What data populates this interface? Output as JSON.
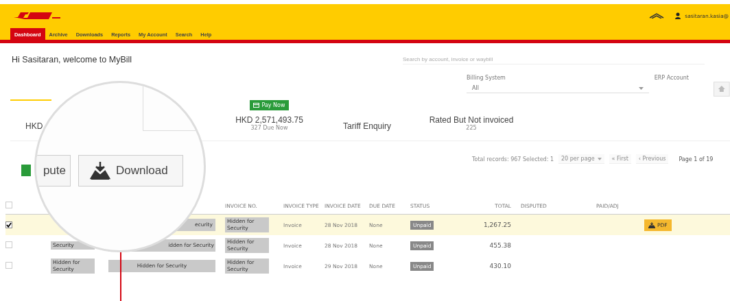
{
  "header": {
    "user": "sasitaran.kasia@"
  },
  "nav": [
    {
      "label": "Dashboard",
      "selected": true
    },
    {
      "label": "Archive",
      "selected": false
    },
    {
      "label": "Downloads",
      "selected": false
    },
    {
      "label": "Reports",
      "selected": false
    },
    {
      "label": "My Account",
      "selected": false
    },
    {
      "label": "Search",
      "selected": false
    },
    {
      "label": "Help",
      "selected": false
    }
  ],
  "welcome": "Hi Sasitaran, welcome to MyBill",
  "search": {
    "placeholder": "Search by account, invoice or waybill"
  },
  "filters": [
    {
      "label": "Billing System",
      "value": "All"
    },
    {
      "label": "ERP Account"
    }
  ],
  "summary": [
    {
      "title": "HKD",
      "selected": true
    },
    {
      "badge": "Pay Now",
      "title": "HKD 2,571,493.75",
      "sub": "327 Due Now",
      "selected": false
    },
    {
      "title": "Tariff Enquiry",
      "selected": false
    },
    {
      "title": "Rated But Not invoiced",
      "sub": "225",
      "selected": false
    }
  ],
  "pager": {
    "records": "Total records: 967  Selected: 1",
    "per_page": "20 per page",
    "first": "« First",
    "previous": "‹ Previous",
    "page": "Page 1 of 19"
  },
  "magnifier": {
    "buttons": [
      "pute",
      "Download"
    ]
  },
  "table": {
    "select_all": {
      "checked": false
    },
    "columns": [
      "INVOICE NO.",
      "INVOICE TYPE",
      "INVOICE DATE",
      "DUE DATE",
      "STATUS",
      "TOTAL",
      "DISPUTED",
      "PAID/ADJ"
    ],
    "rows": [
      {
        "checked": true,
        "selected": true,
        "company": "ecurity",
        "invoice_no": "Hidden for Security",
        "type": "Invoice",
        "date": "28 Nov 2018",
        "due": "None",
        "status": "Unpaid",
        "total": "1,267.25",
        "action": "PDF"
      },
      {
        "checked": false,
        "selected": false,
        "account": "Security",
        "company": "idden for Security",
        "invoice_no": "Hidden for Security",
        "type": "Invoice",
        "date": "28 Nov 2018",
        "due": "None",
        "status": "Unpaid",
        "total": "455.38"
      },
      {
        "checked": false,
        "selected": false,
        "account": "Hidden for Security",
        "company": "Hidden for Security",
        "invoice_no": "Hidden for Security",
        "type": "Invoice",
        "date": "29 Nov 2018",
        "due": "None",
        "status": "Unpaid",
        "total": "430.10"
      }
    ]
  }
}
